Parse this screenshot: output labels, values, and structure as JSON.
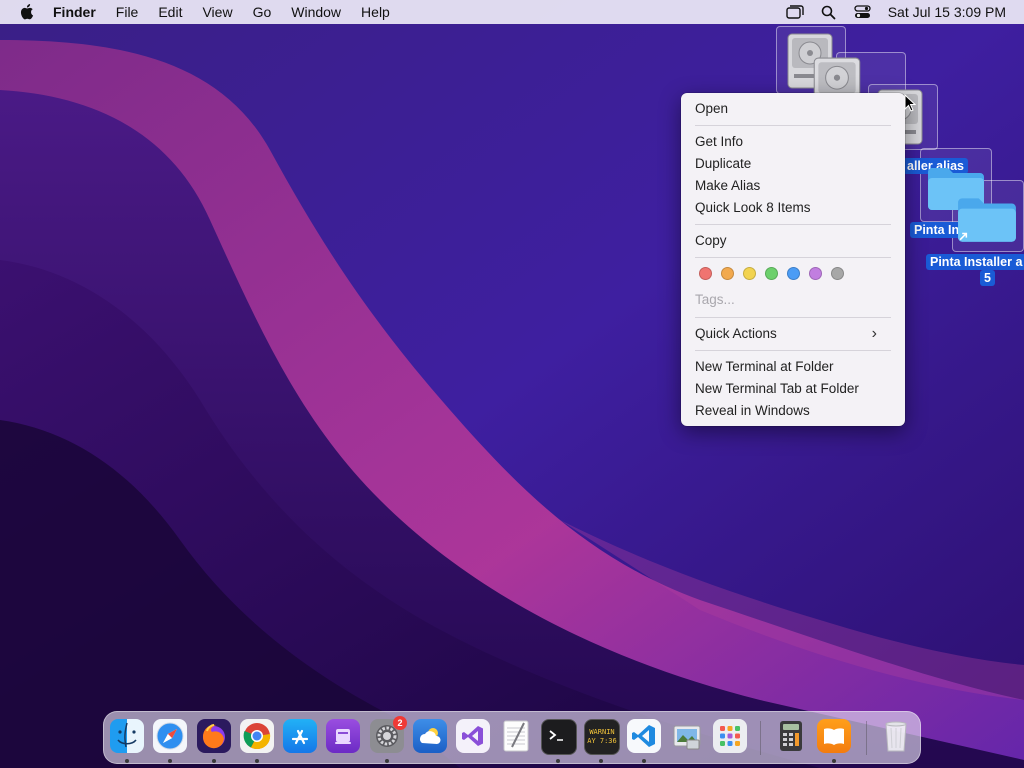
{
  "menubar": {
    "app_name": "Finder",
    "menus": [
      "File",
      "Edit",
      "View",
      "Go",
      "Window",
      "Help"
    ],
    "clock": "Sat Jul 15  3:09 PM"
  },
  "desktop": {
    "alias_label_1": "aller alias",
    "folder_label_1": "Pinta In",
    "folder_label_2_line1": "Pinta Installer a",
    "folder_label_2_line2": "5"
  },
  "context_menu": {
    "open": "Open",
    "get_info": "Get Info",
    "duplicate": "Duplicate",
    "make_alias": "Make Alias",
    "quick_look": "Quick Look 8 Items",
    "copy": "Copy",
    "tag_colors": [
      "#f07470",
      "#f2a94e",
      "#f2d350",
      "#6cd06c",
      "#4b9cf5",
      "#c17ee0",
      "#a7a7a7"
    ],
    "tags": "Tags...",
    "quick_actions": "Quick Actions",
    "new_terminal": "New Terminal at Folder",
    "new_terminal_tab": "New Terminal Tab at Folder",
    "reveal_windows": "Reveal in Windows"
  },
  "dock": {
    "apps": [
      "finder-icon",
      "safari-icon",
      "firefox-icon",
      "chrome-icon",
      "app-store-icon",
      "podcasts-icon",
      "system-settings-icon",
      "weather-icon",
      "visual-studio-icon",
      "textedit-icon",
      "terminal-icon",
      "console-icon",
      "vscode-icon",
      "preview-icon",
      "launchpad-icon",
      "calculator-icon",
      "books-icon",
      "trash-icon"
    ],
    "settings_badge": "2",
    "console_text_line1": "WARNIN",
    "console_text_line2": "AY 7:36"
  }
}
